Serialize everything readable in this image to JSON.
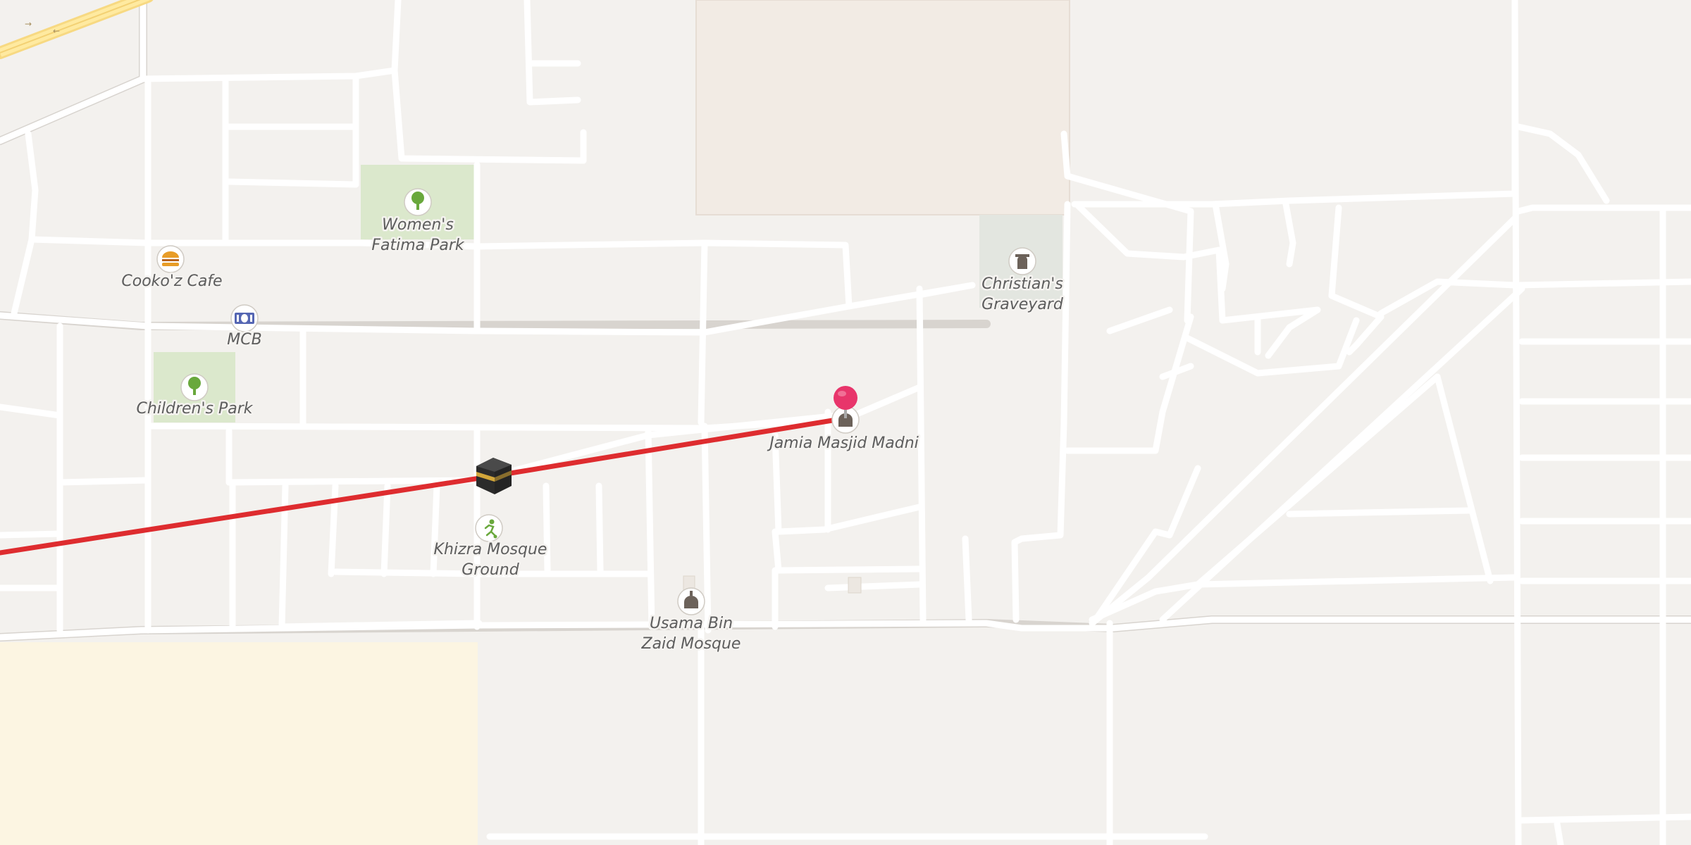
{
  "map": {
    "colors": {
      "land": "#f3f1ee",
      "block": "#f5f3f0",
      "park": "#dbe8cc",
      "cemetery": "#e3e6e0",
      "industrial": "#f2ebe4",
      "sand": "#fcf5e2",
      "road": "#ffffff",
      "route": "#de2c2f",
      "pin": "#e8356b"
    },
    "pois": [
      {
        "id": "womens-fatima-park",
        "lines": [
          "Women's",
          "Fatima Park"
        ],
        "icon": "tree-icon"
      },
      {
        "id": "cookoz-cafe",
        "lines": [
          "Cooko'z Cafe"
        ],
        "icon": "burger-icon"
      },
      {
        "id": "mcb",
        "lines": [
          "MCB"
        ],
        "icon": "banknote-icon"
      },
      {
        "id": "childrens-park",
        "lines": [
          "Children's Park"
        ],
        "icon": "tree-icon"
      },
      {
        "id": "christians-graveyard",
        "lines": [
          "Christian's",
          "Graveyard"
        ],
        "icon": "tombstone-icon"
      },
      {
        "id": "jamia-masjid-madni",
        "lines": [
          "Jamia Masjid Madni"
        ],
        "icon": "mosque-icon"
      },
      {
        "id": "khizra-mosque-ground",
        "lines": [
          "Khizra Mosque",
          "Ground"
        ],
        "icon": "soccer-player-icon"
      },
      {
        "id": "usama-bin-zaid-mosque",
        "lines": [
          "Usama Bin",
          "Zaid Mosque"
        ],
        "icon": "mosque-icon"
      }
    ],
    "kaaba_icon": "kaaba-icon",
    "pin_icon": "location-pin-icon",
    "route_line": "qibla-direction-line"
  }
}
